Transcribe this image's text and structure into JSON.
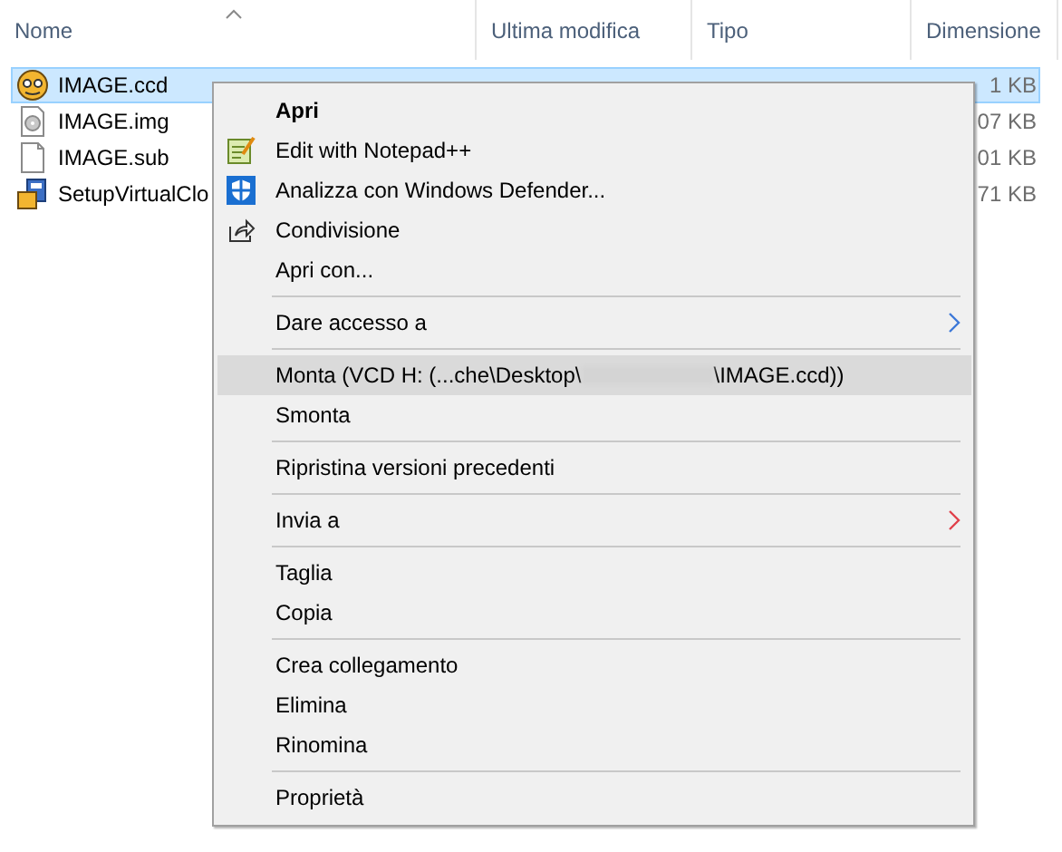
{
  "columns": [
    {
      "label": "Nome",
      "sorted": true
    },
    {
      "label": "Ultima modifica",
      "sorted": false
    },
    {
      "label": "Tipo",
      "sorted": false
    },
    {
      "label": "Dimensione",
      "sorted": false
    }
  ],
  "files": [
    {
      "name": "IMAGE.ccd",
      "size": "1 KB",
      "selected": true
    },
    {
      "name": "IMAGE.img",
      "size": "07 KB",
      "selected": false
    },
    {
      "name": "IMAGE.sub",
      "size": "01 KB",
      "selected": false
    },
    {
      "name": "SetupVirtualClo",
      "size": "71 KB",
      "selected": false
    }
  ],
  "context_menu": {
    "items": [
      {
        "kind": "item",
        "label": "Apri",
        "default": true,
        "selected": false
      },
      {
        "kind": "item",
        "label": "Edit with Notepad++",
        "default": false,
        "selected": false
      },
      {
        "kind": "item",
        "label": "Analizza con Windows Defender...",
        "default": false,
        "selected": false
      },
      {
        "kind": "item",
        "label": "Condivisione",
        "default": false,
        "selected": false
      },
      {
        "kind": "item",
        "label": "Apri con...",
        "default": false,
        "selected": false
      },
      {
        "kind": "separator"
      },
      {
        "kind": "submenu",
        "label": "Dare accesso a",
        "default": false,
        "selected": false,
        "color": "#3c78d8"
      },
      {
        "kind": "separator"
      },
      {
        "kind": "redacted",
        "label": "Monta (VCD H: (...che\\Desktop\\",
        "label_end": "\\IMAGE.ccd))",
        "default": false,
        "selected": true
      },
      {
        "kind": "item",
        "label": "Smonta",
        "default": false,
        "selected": false
      },
      {
        "kind": "separator"
      },
      {
        "kind": "item",
        "label": "Ripristina versioni precedenti",
        "default": false,
        "selected": false
      },
      {
        "kind": "separator"
      },
      {
        "kind": "submenu",
        "label": "Invia a",
        "default": false,
        "selected": false,
        "color": "#e0404a"
      },
      {
        "kind": "separator"
      },
      {
        "kind": "item",
        "label": "Taglia",
        "default": false,
        "selected": false
      },
      {
        "kind": "item",
        "label": "Copia",
        "default": false,
        "selected": false
      },
      {
        "kind": "separator"
      },
      {
        "kind": "item",
        "label": "Crea collegamento",
        "default": false,
        "selected": false
      },
      {
        "kind": "item",
        "label": "Elimina",
        "default": false,
        "selected": false
      },
      {
        "kind": "item",
        "label": "Rinomina",
        "default": false,
        "selected": false
      },
      {
        "kind": "separator"
      },
      {
        "kind": "item",
        "label": "Proprietà",
        "default": false,
        "selected": false
      }
    ]
  }
}
